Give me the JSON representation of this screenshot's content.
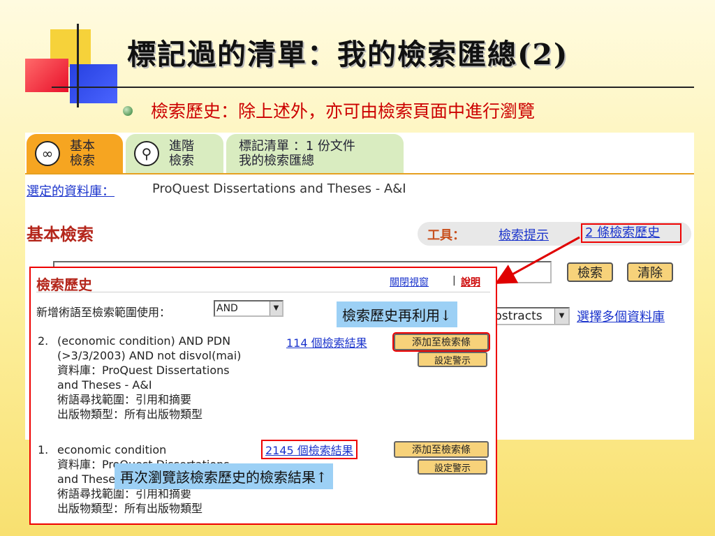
{
  "slide": {
    "title": "標記過的清單：我的檢索匯總(2)",
    "subtitle": "檢索歷史：除上述外，亦可由檢索頁面中進行瀏覽"
  },
  "tabs": [
    {
      "line1": "基本",
      "line2": "檢索",
      "icon": "glasses-icon"
    },
    {
      "line1": "進階",
      "line2": "檢索",
      "icon": "magnifier-icon"
    },
    {
      "line1": "標記清單 ：1 份文件",
      "line2": "我的檢索匯總"
    }
  ],
  "database": {
    "label": "選定的資料庫：",
    "value": "ProQuest Dissertations and Theses - A&I"
  },
  "basic_search": {
    "title": "基本檢索",
    "tools_label": "工具：",
    "tools_hint": "檢索提示",
    "tools_history": "2 條檢索歷史",
    "search_button": "檢索",
    "clear_button": "清除",
    "field_select_value": "bstracts",
    "multi_db_link": "選擇多個資料庫"
  },
  "history_popup": {
    "title": "檢索歷史",
    "close_link": "關閉視窗",
    "separator": "|",
    "help_link": "說明",
    "new_term_label": "新增術語至檢索範圍使用：",
    "operator_value": "AND",
    "items": [
      {
        "number": "2.",
        "lines": [
          "(economic condition) AND PDN",
          "(>3/3/2003) AND not disvol(mai)",
          "資料庫：ProQuest Dissertations",
          "and Theses - A&I",
          "術語尋找範圍：引用和摘要",
          "出版物類型：所有出版物類型"
        ],
        "result_link": "114 個檢索結果",
        "add_button": "添加至檢索條",
        "alert_button": "設定警示"
      },
      {
        "number": "1.",
        "lines": [
          "economic condition",
          "資料庫：ProQuest Dissertations",
          "and Theses - A&I",
          "術語尋找範圍：引用和摘要",
          "出版物類型：所有出版物類型"
        ],
        "result_link": "2145 個檢索結果",
        "add_button": "添加至檢索條",
        "alert_button": "設定警示"
      }
    ]
  },
  "callouts": {
    "reuse": "檢索歷史再利用↓",
    "browse": "再次瀏覽該檢索歷史的檢索結果↑"
  },
  "colors": {
    "accent_red": "#e00000",
    "link_blue": "#1a33cc",
    "tab_orange": "#f6a521",
    "tab_green": "#d9ecc0",
    "button_yellow": "#f7d27a",
    "callout_blue": "#9cd0f5"
  }
}
